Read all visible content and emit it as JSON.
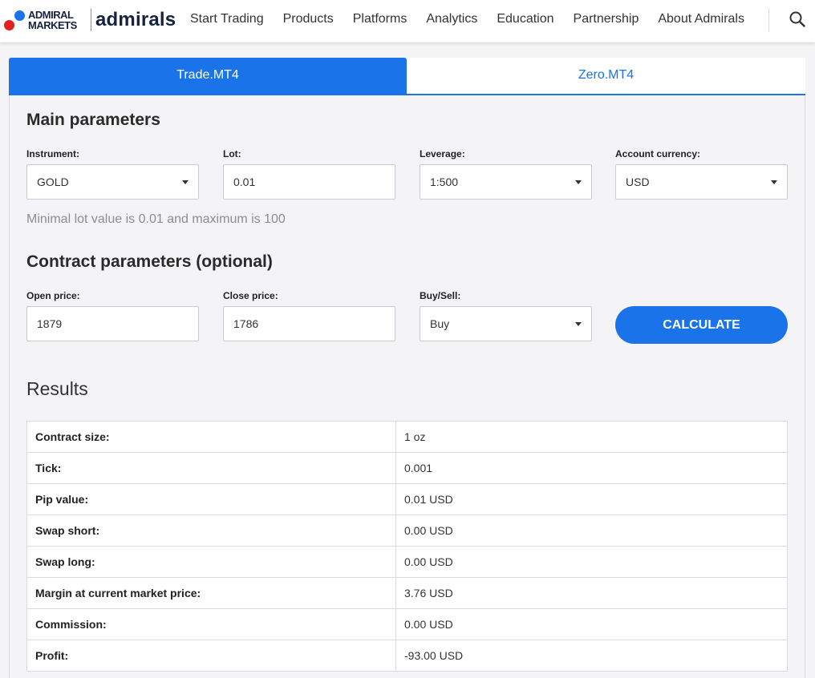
{
  "header": {
    "logo_line1": "ADMIRAL",
    "logo_line2": "MARKETS",
    "logo_brand": "admirals",
    "nav": [
      "Start Trading",
      "Products",
      "Platforms",
      "Analytics",
      "Education",
      "Partnership",
      "About Admirals"
    ],
    "search_icon": "search-icon"
  },
  "tabs": [
    {
      "label": "Trade.MT4",
      "active": true
    },
    {
      "label": "Zero.MT4",
      "active": false
    }
  ],
  "main_params": {
    "title": "Main parameters",
    "instrument": {
      "label": "Instrument:",
      "value": "GOLD"
    },
    "lot": {
      "label": "Lot:",
      "value": "0.01"
    },
    "leverage": {
      "label": "Leverage:",
      "value": "1:500"
    },
    "currency": {
      "label": "Account currency:",
      "value": "USD"
    },
    "hint": "Minimal lot value is 0.01 and maximum is 100"
  },
  "contract_params": {
    "title": "Contract parameters (optional)",
    "open_price": {
      "label": "Open price:",
      "value": "1879"
    },
    "close_price": {
      "label": "Close price:",
      "value": "1786"
    },
    "buy_sell": {
      "label": "Buy/Sell:",
      "value": "Buy"
    },
    "calculate_label": "CALCULATE"
  },
  "results": {
    "title": "Results",
    "rows": [
      {
        "key": "Contract size:",
        "value": "1 oz"
      },
      {
        "key": "Tick:",
        "value": "0.001"
      },
      {
        "key": "Pip value:",
        "value": "0.01 USD"
      },
      {
        "key": "Swap short:",
        "value": "0.00 USD"
      },
      {
        "key": "Swap long:",
        "value": "0.00 USD"
      },
      {
        "key": "Margin at current market price:",
        "value": "3.76 USD"
      },
      {
        "key": "Commission:",
        "value": "0.00 USD"
      },
      {
        "key": "Profit:",
        "value": "-93.00 USD"
      }
    ]
  },
  "colors": {
    "accent": "#1a73e8",
    "logo_red": "#e02020",
    "brand_navy": "#16223f"
  }
}
